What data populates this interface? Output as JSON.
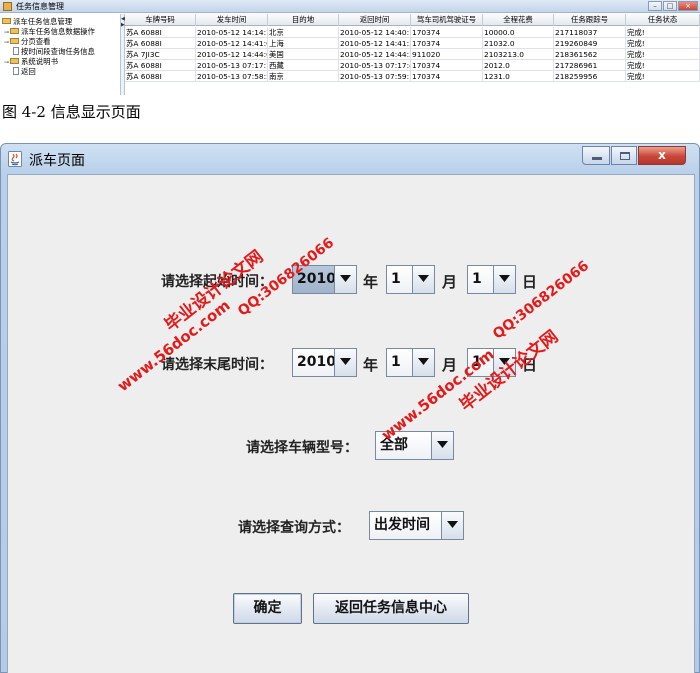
{
  "top_window": {
    "title": "任务信息管理",
    "tree": [
      {
        "label": "派车任务信息管理",
        "kind": "folder"
      },
      {
        "label": "派车任务信息数据操作",
        "kind": "folder"
      },
      {
        "label": "分页查看",
        "kind": "folder"
      },
      {
        "label": "按时间段查询任务信息",
        "kind": "page"
      },
      {
        "label": "系统说明书",
        "kind": "folder"
      },
      {
        "label": "返回",
        "kind": "page"
      }
    ],
    "columns": [
      "车牌号码",
      "发车时间",
      "目的地",
      "返回时间",
      "驾车司机驾驶证号",
      "全程花费",
      "任务跟踪号",
      "任务状态"
    ],
    "rows": [
      [
        "苏A 6088I",
        "2010-05-12 14:14:1...",
        "北京",
        "2010-05-12 14:40:1...",
        "170374",
        "10000.0",
        "217118037",
        "完成!"
      ],
      [
        "苏A 6088I",
        "2010-05-12 14:41:0...",
        "上海",
        "2010-05-12 14:41:3...",
        "170374",
        "21032.0",
        "219260849",
        "完成!"
      ],
      [
        "苏A 7JI3C",
        "2010-05-12 14:44:0...",
        "美国",
        "2010-05-12 14:44:3...",
        "911020",
        "2103213.0",
        "218361562",
        "完成!"
      ],
      [
        "苏A 6088I",
        "2010-05-13 07:17:1...",
        "西藏",
        "2010-05-13 07:17:4...",
        "170374",
        "2012.0",
        "217286961",
        "完成!"
      ],
      [
        "苏A 6088I",
        "2010-05-13 07:58:5...",
        "南京",
        "2010-05-13 07:59:1...",
        "170374",
        "1231.0",
        "218259956",
        "完成!"
      ]
    ]
  },
  "caption": "图 4-2 信息显示页面",
  "dialog": {
    "title": "派车页面",
    "close_glyph": "x",
    "start": {
      "label": "请选择起始时间：",
      "year": "2010",
      "year_unit": "年",
      "month": "1",
      "month_unit": "月",
      "day": "1",
      "day_unit": "日"
    },
    "end": {
      "label": "请选择末尾时间：",
      "year": "2010",
      "year_unit": "年",
      "month": "1",
      "month_unit": "月",
      "day": "1",
      "day_unit": "日"
    },
    "vehicle": {
      "label": "请选择车辆型号：",
      "value": "全部"
    },
    "query": {
      "label": "请选择查询方式：",
      "value": "出发时间"
    },
    "ok_button": "确定",
    "back_button": "返回任务信息中心"
  },
  "watermark": {
    "site": "www.56doc.com",
    "brand": "毕业设计论文网",
    "qq": "QQ:306826066",
    "color": "#e41a1a"
  }
}
